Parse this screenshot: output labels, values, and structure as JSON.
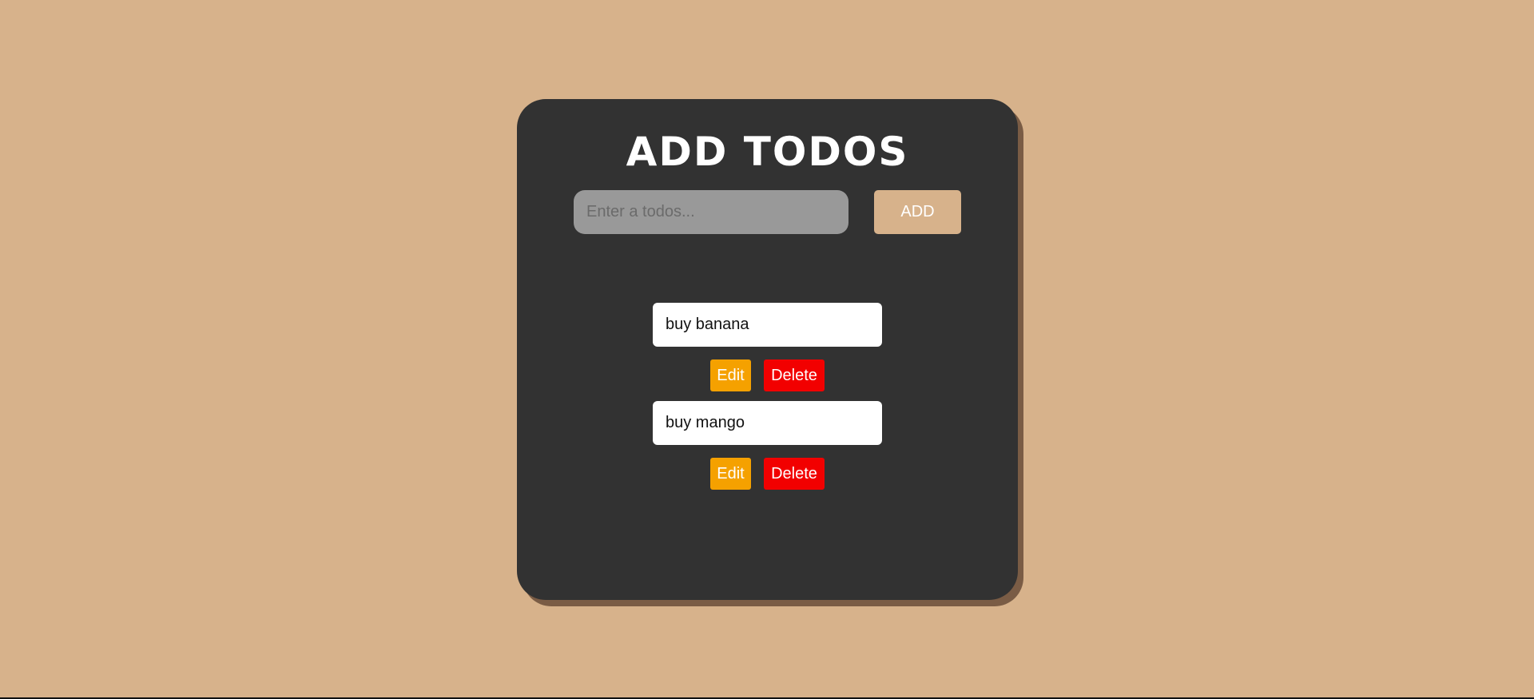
{
  "app": {
    "title": "ADD TODOS",
    "input": {
      "placeholder": "Enter a todos...",
      "value": ""
    },
    "add_button_label": "ADD",
    "todos": [
      {
        "text": "buy banana",
        "edit_label": "Edit",
        "delete_label": "Delete"
      },
      {
        "text": "buy mango",
        "edit_label": "Edit",
        "delete_label": "Delete"
      }
    ]
  },
  "colors": {
    "background": "#d7b28b",
    "card": "#323232",
    "card_shadow": "#7a5c45",
    "input": "#999999",
    "add_button": "#d7b28b",
    "edit_button": "#f5a100",
    "delete_button": "#f20000"
  }
}
